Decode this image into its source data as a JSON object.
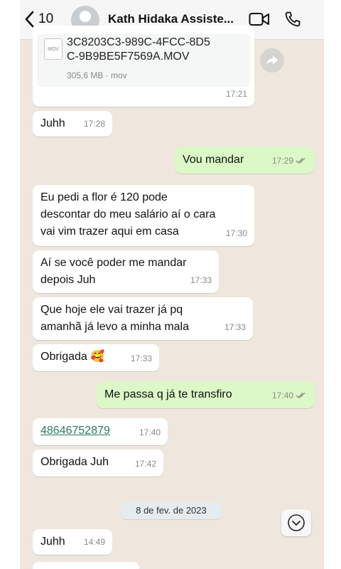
{
  "header": {
    "back_count": "10",
    "contact_name": "Kath Hidaka Assiste..."
  },
  "attachment": {
    "type_label": "MOV",
    "file_name_line1": "3C8203C3-989C-4FCC-8D5",
    "file_name_line2": "C-9B9BE5F7569A.MOV",
    "file_meta": "305,6 MB · mov",
    "time": "17:21"
  },
  "messages": [
    {
      "direction": "in",
      "text": "Juhh",
      "time": "17:28"
    },
    {
      "direction": "out",
      "text": "Vou mandar",
      "time": "17:29"
    },
    {
      "direction": "in",
      "lines": [
        "Eu pedi a flor é 120 pode",
        "descontar do meu salário aí o cara",
        "vai vim trazer aqui em casa"
      ],
      "time": "17:30"
    },
    {
      "direction": "in",
      "lines": [
        "Aí se você poder me mandar",
        "depois Juh"
      ],
      "time": "17:33"
    },
    {
      "direction": "in",
      "lines": [
        "Que hoje ele vai trazer já pq",
        "amanhã já levo a minha mala"
      ],
      "time": "17:33"
    },
    {
      "direction": "in",
      "text": "Obrigada 🥰",
      "time": "17:33"
    },
    {
      "direction": "out",
      "text": "Me passa q já te transfiro",
      "time": "17:40"
    },
    {
      "direction": "in",
      "link": "48646752879",
      "time": "17:40"
    },
    {
      "direction": "in",
      "text": "Obrigada Juh",
      "time": "17:42"
    },
    {
      "direction": "in",
      "text": "Juhh",
      "time": "14:49"
    }
  ],
  "date_separator": "8 de fev. de 2023",
  "colors": {
    "chat_background": "#efe7dd",
    "incoming_bubble": "#ffffff",
    "outgoing_bubble": "#dcf8c6",
    "read_tick": "#8a8a8a",
    "link": "#2a7a62"
  },
  "icons": [
    "chevron-left-icon",
    "avatar",
    "video-camera-icon",
    "phone-icon",
    "forward-icon",
    "chevron-down-icon",
    "double-check-icon",
    "file-icon"
  ]
}
